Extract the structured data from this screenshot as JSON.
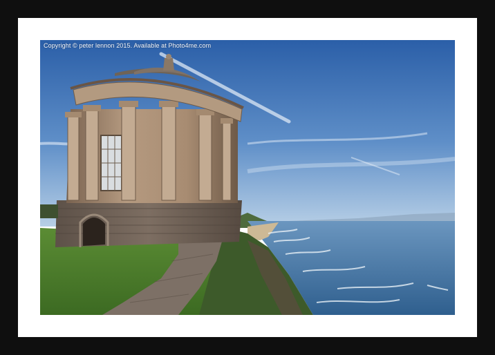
{
  "image": {
    "description_type": "framed-print-photo",
    "watermark": "Copyright © peter lennon 2015. Available at Photo4me.com",
    "colors": {
      "frame": "#0f0f0f",
      "mount": "#ffffff",
      "sky_top": "#2f66b0",
      "sky_bottom": "#a9c6e4",
      "sea": "#3f74a3",
      "grass": "#4a7a2a",
      "stone": "#9b8672"
    }
  }
}
